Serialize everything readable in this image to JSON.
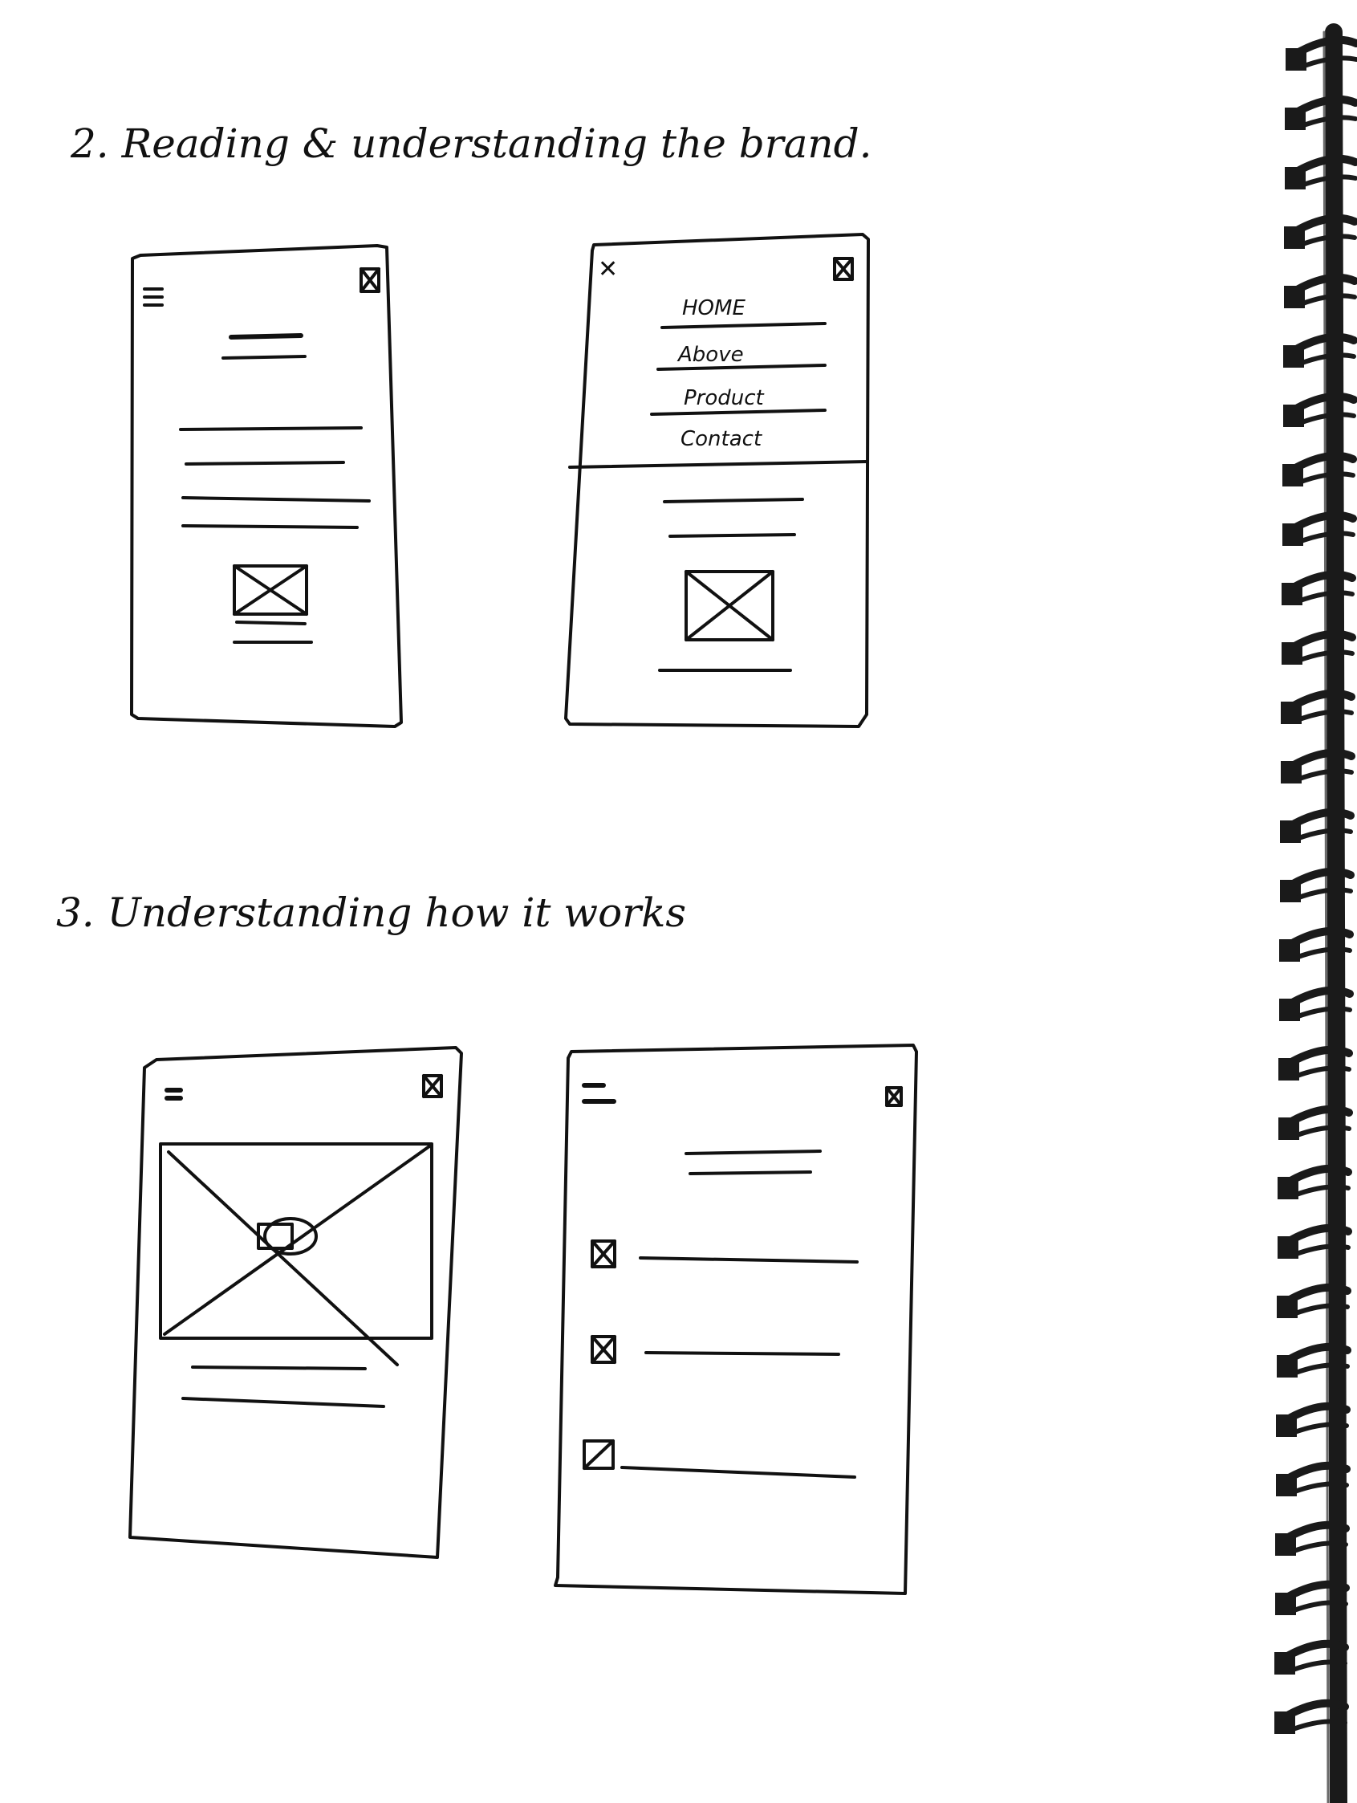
{
  "sections": [
    {
      "number": "2.",
      "title": "Reading & understanding the brand."
    },
    {
      "number": "3.",
      "title": "Understanding how it works"
    }
  ],
  "menu": {
    "close_glyph": "✕",
    "items": [
      "HOME",
      "Above",
      "Product",
      "Contact"
    ]
  },
  "icons": {
    "hamburger": "hamburger-icon",
    "close": "close-icon",
    "image_placeholder": "image-placeholder-icon"
  },
  "colors": {
    "ink": "#111111",
    "paper": "#ffffff",
    "spiral": "#1a1a1a"
  }
}
